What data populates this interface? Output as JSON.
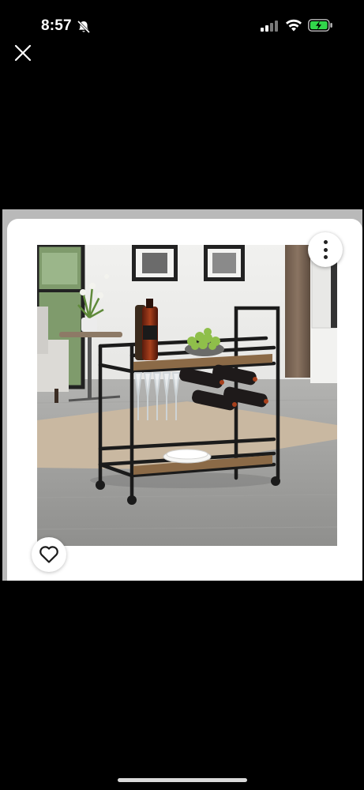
{
  "status_bar": {
    "time": "8:57",
    "icons": [
      "bell-slash-icon",
      "cellular-signal-icon",
      "wifi-icon",
      "battery-charging-icon"
    ],
    "battery_color": "#32d74b"
  },
  "toolbar": {
    "close_icon": "close-icon"
  },
  "product_image": {
    "description_icon": "bar-cart-photo",
    "more_icon": "more-vertical-icon",
    "favorite_icon": "heart-icon"
  },
  "colors": {
    "background": "#000000",
    "card": "#ffffff",
    "card_frame": "#b9b9b9"
  }
}
